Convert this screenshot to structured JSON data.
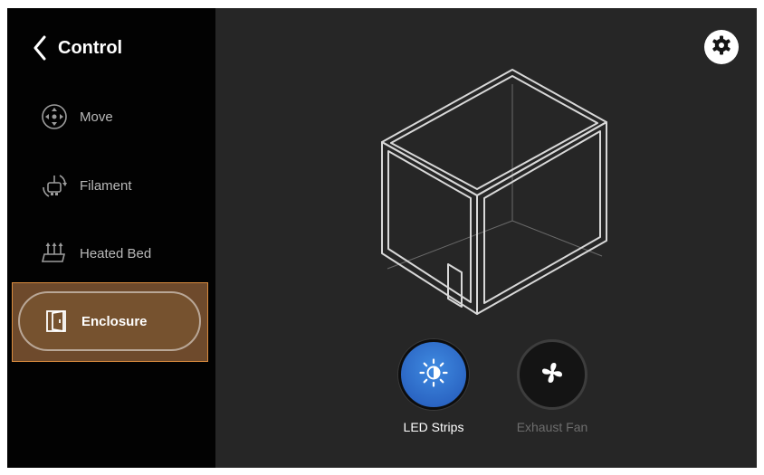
{
  "header": {
    "title": "Control",
    "back_icon": "chevron-left-icon"
  },
  "nav": {
    "items": [
      {
        "label": "Move",
        "icon": "move-arrows-icon",
        "selected": false
      },
      {
        "label": "Filament",
        "icon": "filament-spool-icon",
        "selected": false
      },
      {
        "label": "Heated Bed",
        "icon": "heated-bed-icon",
        "selected": false
      },
      {
        "label": "Enclosure",
        "icon": "enclosure-door-icon",
        "selected": true
      }
    ]
  },
  "toolbar": {
    "settings_icon": "gear-icon"
  },
  "controls": {
    "led": {
      "label": "LED Strips",
      "icon": "brightness-icon",
      "active": true
    },
    "fan": {
      "label": "Exhaust Fan",
      "icon": "fan-icon",
      "active": false
    }
  },
  "colors": {
    "sidebar_bg": "#020202",
    "main_bg": "#262626",
    "selected_fill": "#76522f",
    "selected_highlight_border": "#d98b3e",
    "led_active": "#2f6fd0",
    "inactive_text": "#6d6d6d"
  }
}
